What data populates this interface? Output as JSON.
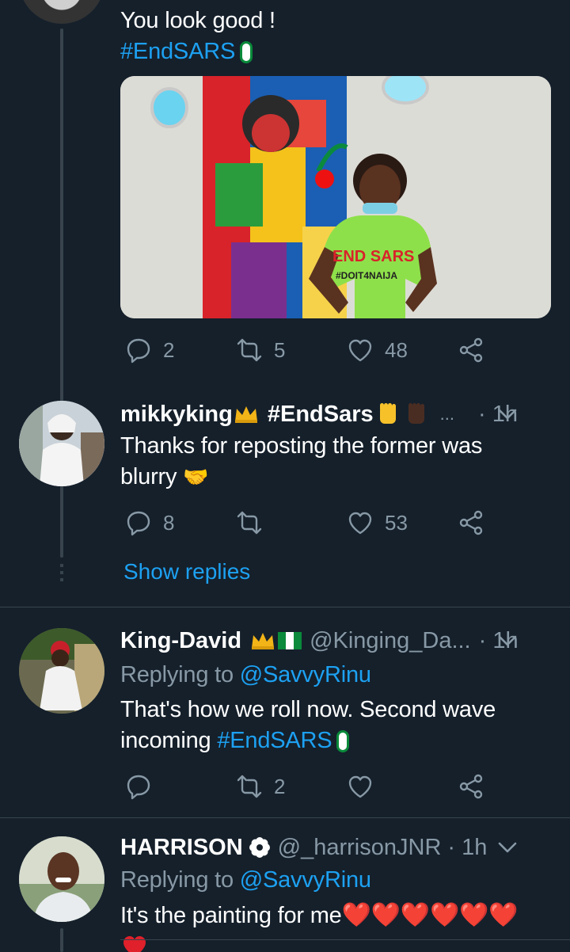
{
  "tweet1": {
    "text": "You look good !",
    "hashtag": "#EndSARS",
    "photo_text_1": "END SARS",
    "photo_text_2": "#DOIT4NAIJA",
    "replies": "2",
    "retweets": "5",
    "likes": "48"
  },
  "tweet2": {
    "name": "mikkyking",
    "hashtag": "#EndSars",
    "ellipsis": "...",
    "time": "· 1h",
    "text_line1": "Thanks for reposting the former was",
    "text_line2": "blurry",
    "handshake": "🤝",
    "replies": "8",
    "likes": "53"
  },
  "show_replies": "Show replies",
  "tweet3": {
    "name": "King-David",
    "handle": "@Kinging_Da...",
    "time": "· 1h",
    "replying_label": "Replying to",
    "replying_to": "@SavvyRinu",
    "text_line1": "That's how we roll now. Second wave",
    "text_line2": "incoming",
    "hashtag": "#EndSARS",
    "retweets": "2"
  },
  "tweet4": {
    "name": "HARRISON",
    "handle": "@_harrisonJNR",
    "time": "· 1h",
    "replying_label": "Replying to",
    "replying_to": "@SavvyRinu",
    "text": "It's the painting for me",
    "hearts": "❤️❤️❤️❤️❤️❤️"
  },
  "colors": {
    "background": "#15202b",
    "accent": "#1da1f2",
    "muted": "#8899a6",
    "divider": "#38444d"
  }
}
